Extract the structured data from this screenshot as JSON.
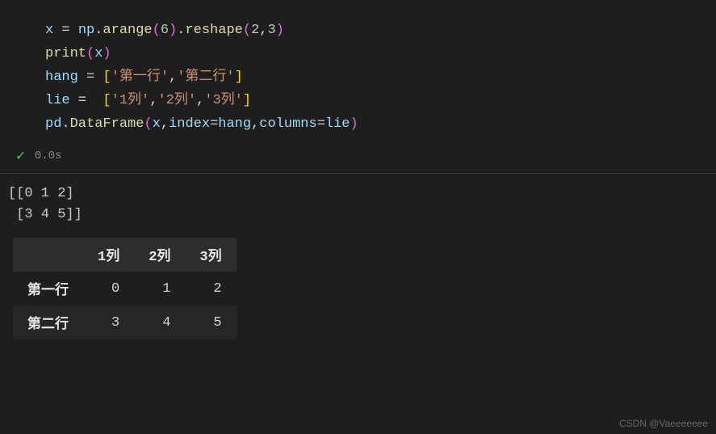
{
  "code": {
    "line1_tokens": [
      "x",
      " = ",
      "np",
      ".",
      "arange",
      "(",
      "6",
      ")",
      ".",
      "reshape",
      "(",
      "2",
      ",",
      "3",
      ")"
    ],
    "line2_tokens": [
      "print",
      "(",
      "x",
      ")"
    ],
    "line3_tokens": [
      "hang",
      " = ",
      "[",
      "'第一行'",
      ",",
      "'第二行'",
      "]"
    ],
    "line4_tokens": [
      "lie",
      " =  ",
      "[",
      "'1列'",
      ",",
      "'2列'",
      ",",
      "'3列'",
      "]"
    ],
    "line5_tokens": [
      "pd",
      ".",
      "DataFrame",
      "(",
      "x",
      ",",
      "index",
      "=",
      "hang",
      ",",
      "columns",
      "=",
      "lie",
      ")"
    ]
  },
  "execution": {
    "status": "success",
    "time": "0.0s"
  },
  "output": {
    "text_line1": "[[0 1 2]",
    "text_line2": " [3 4 5]]"
  },
  "dataframe": {
    "columns": [
      "1列",
      "2列",
      "3列"
    ],
    "index": [
      "第一行",
      "第二行"
    ],
    "rows": [
      [
        "0",
        "1",
        "2"
      ],
      [
        "3",
        "4",
        "5"
      ]
    ]
  },
  "watermark": "CSDN @Vaeeeeeee"
}
